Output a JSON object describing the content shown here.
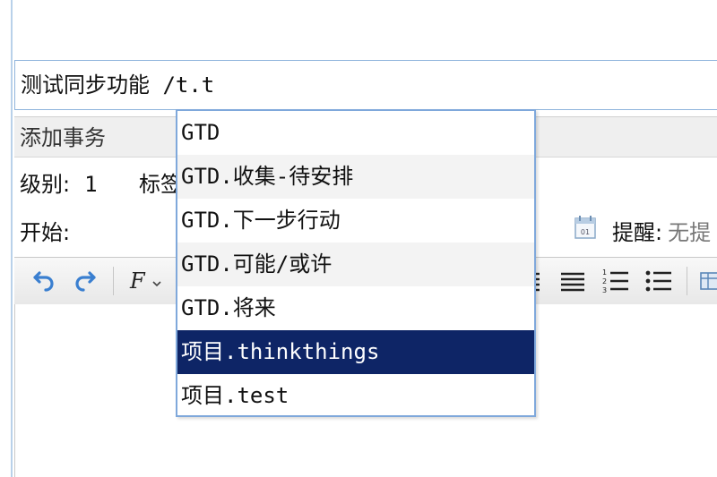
{
  "task_title_input": {
    "value": "测试同步功能 /t.t"
  },
  "panel": {
    "caption": "添加事务"
  },
  "meta": {
    "level_label": "级别:",
    "level_value": "1",
    "tag_label": "标签",
    "start_label": "开始:",
    "reminder_label": "提醒:",
    "reminder_value": "无提"
  },
  "toolbar": {
    "icons": [
      "undo-icon",
      "redo-icon",
      "font-icon",
      "align-justify-icon",
      "ordered-list-icon",
      "unordered-list-icon",
      "table-icon"
    ]
  },
  "autocomplete": {
    "items": [
      {
        "label": "GTD"
      },
      {
        "label": "GTD.收集-待安排"
      },
      {
        "label": "GTD.下一步行动"
      },
      {
        "label": "GTD.可能/或许"
      },
      {
        "label": "GTD.将来"
      },
      {
        "label": "项目.thinkthings"
      },
      {
        "label": "项目.test"
      }
    ],
    "selected_label": "项目.thinkthings"
  },
  "colors": {
    "selected_bg": "#0e2566",
    "border_accent": "#7fa8db",
    "toolbar_icon_blue": "#3a7fd0"
  }
}
